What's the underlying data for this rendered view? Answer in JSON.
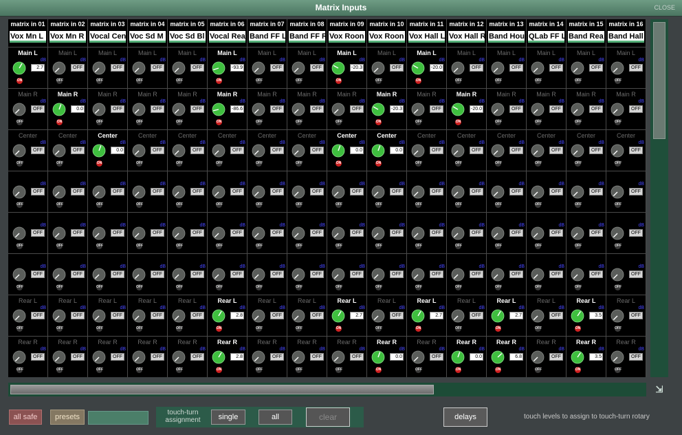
{
  "window": {
    "title": "Matrix Inputs",
    "close_label": "CLOSE"
  },
  "slot_names": [
    "Main L",
    "Main R",
    "Center",
    "",
    "",
    "",
    "Rear L",
    "Rear R"
  ],
  "db_unit": "dB",
  "on_label": "ON",
  "off_label": "OFF",
  "columns": [
    {
      "label": "matrix in 01",
      "name": "Vox Mn L",
      "values": [
        "2.7",
        "OFF",
        "OFF",
        "OFF",
        "OFF",
        "OFF",
        "OFF",
        "OFF"
      ]
    },
    {
      "label": "matrix in 02",
      "name": "Vox Mn R",
      "values": [
        "OFF",
        "0.0",
        "OFF",
        "OFF",
        "OFF",
        "OFF",
        "OFF",
        "OFF"
      ]
    },
    {
      "label": "matrix in 03",
      "name": "Vocal Cen",
      "values": [
        "OFF",
        "OFF",
        "0.0",
        "OFF",
        "OFF",
        "OFF",
        "OFF",
        "OFF"
      ]
    },
    {
      "label": "matrix in 04",
      "name": "Voc Sd M",
      "values": [
        "OFF",
        "OFF",
        "OFF",
        "OFF",
        "OFF",
        "OFF",
        "OFF",
        "OFF"
      ]
    },
    {
      "label": "matrix in 05",
      "name": "Voc Sd Bl",
      "values": [
        "OFF",
        "OFF",
        "OFF",
        "OFF",
        "OFF",
        "OFF",
        "OFF",
        "OFF"
      ]
    },
    {
      "label": "matrix in 06",
      "name": "Vocal Rea",
      "values": [
        "-93.9",
        "-86.6",
        "OFF",
        "OFF",
        "OFF",
        "OFF",
        "2.8",
        "2.8"
      ]
    },
    {
      "label": "matrix in 07",
      "name": "Band FF L",
      "values": [
        "OFF",
        "OFF",
        "OFF",
        "OFF",
        "OFF",
        "OFF",
        "OFF",
        "OFF"
      ]
    },
    {
      "label": "matrix in 08",
      "name": "Band FF R",
      "values": [
        "OFF",
        "OFF",
        "OFF",
        "OFF",
        "OFF",
        "OFF",
        "OFF",
        "OFF"
      ]
    },
    {
      "label": "matrix in 09",
      "name": "Vox Roon",
      "values": [
        "-20.3",
        "OFF",
        "0.0",
        "OFF",
        "OFF",
        "OFF",
        "2.7",
        "OFF"
      ]
    },
    {
      "label": "matrix in 10",
      "name": "Vox Roon",
      "values": [
        "OFF",
        "-20.3",
        "0.0",
        "OFF",
        "OFF",
        "OFF",
        "OFF",
        "0.0"
      ]
    },
    {
      "label": "matrix in 11",
      "name": "Vox Hall L",
      "values": [
        "-20.0",
        "OFF",
        "OFF",
        "OFF",
        "OFF",
        "OFF",
        "2.7",
        "OFF"
      ]
    },
    {
      "label": "matrix in 12",
      "name": "Vox Hall R",
      "values": [
        "OFF",
        "-20.0",
        "OFF",
        "OFF",
        "OFF",
        "OFF",
        "OFF",
        "0.0"
      ]
    },
    {
      "label": "matrix in 13",
      "name": "Band Hou",
      "values": [
        "OFF",
        "OFF",
        "OFF",
        "OFF",
        "OFF",
        "OFF",
        "2.7",
        "6.8"
      ]
    },
    {
      "label": "matrix in 14",
      "name": "QLab FF L",
      "values": [
        "OFF",
        "OFF",
        "OFF",
        "OFF",
        "OFF",
        "OFF",
        "OFF",
        "OFF"
      ]
    },
    {
      "label": "matrix in 15",
      "name": "Band Rea",
      "values": [
        "OFF",
        "OFF",
        "OFF",
        "OFF",
        "OFF",
        "OFF",
        "3.5",
        "3.5"
      ]
    },
    {
      "label": "matrix in 16",
      "name": "Band Hall",
      "values": [
        "OFF",
        "OFF",
        "OFF",
        "OFF",
        "OFF",
        "OFF",
        "OFF",
        "OFF"
      ]
    }
  ],
  "bottom": {
    "all_safe": "all safe",
    "presets": "presets",
    "preset_name": "",
    "touch_turn_label": "touch-turn assignment",
    "single": "single",
    "all": "all",
    "clear": "clear",
    "delays": "delays",
    "hint": "touch levels to assign to touch-turn rotary"
  },
  "colors": {
    "title_bar": "#5a8872",
    "knob_on": "#3fbf3f",
    "knob_off": "#5a5d5a",
    "switch_on": "#cf2020",
    "name_underline": "#55b079"
  }
}
